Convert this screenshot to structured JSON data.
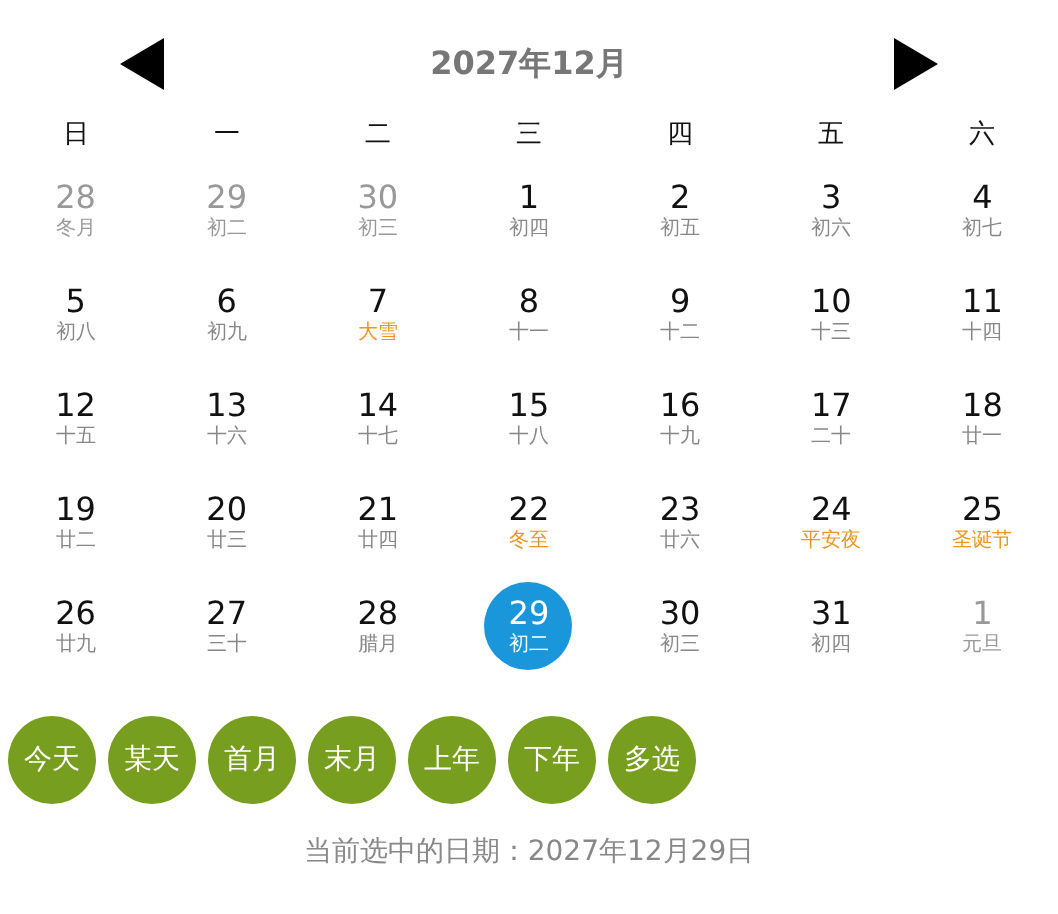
{
  "header": {
    "title": "2027年12月"
  },
  "weekdays": [
    "日",
    "一",
    "二",
    "三",
    "四",
    "五",
    "六"
  ],
  "days": [
    {
      "day": "28",
      "lunar": "冬月",
      "in_month": false,
      "festive": false,
      "selected": false
    },
    {
      "day": "29",
      "lunar": "初二",
      "in_month": false,
      "festive": false,
      "selected": false
    },
    {
      "day": "30",
      "lunar": "初三",
      "in_month": false,
      "festive": false,
      "selected": false
    },
    {
      "day": "1",
      "lunar": "初四",
      "in_month": true,
      "festive": false,
      "selected": false
    },
    {
      "day": "2",
      "lunar": "初五",
      "in_month": true,
      "festive": false,
      "selected": false
    },
    {
      "day": "3",
      "lunar": "初六",
      "in_month": true,
      "festive": false,
      "selected": false
    },
    {
      "day": "4",
      "lunar": "初七",
      "in_month": true,
      "festive": false,
      "selected": false
    },
    {
      "day": "5",
      "lunar": "初八",
      "in_month": true,
      "festive": false,
      "selected": false
    },
    {
      "day": "6",
      "lunar": "初九",
      "in_month": true,
      "festive": false,
      "selected": false
    },
    {
      "day": "7",
      "lunar": "大雪",
      "in_month": true,
      "festive": true,
      "selected": false
    },
    {
      "day": "8",
      "lunar": "十一",
      "in_month": true,
      "festive": false,
      "selected": false
    },
    {
      "day": "9",
      "lunar": "十二",
      "in_month": true,
      "festive": false,
      "selected": false
    },
    {
      "day": "10",
      "lunar": "十三",
      "in_month": true,
      "festive": false,
      "selected": false
    },
    {
      "day": "11",
      "lunar": "十四",
      "in_month": true,
      "festive": false,
      "selected": false
    },
    {
      "day": "12",
      "lunar": "十五",
      "in_month": true,
      "festive": false,
      "selected": false
    },
    {
      "day": "13",
      "lunar": "十六",
      "in_month": true,
      "festive": false,
      "selected": false
    },
    {
      "day": "14",
      "lunar": "十七",
      "in_month": true,
      "festive": false,
      "selected": false
    },
    {
      "day": "15",
      "lunar": "十八",
      "in_month": true,
      "festive": false,
      "selected": false
    },
    {
      "day": "16",
      "lunar": "十九",
      "in_month": true,
      "festive": false,
      "selected": false
    },
    {
      "day": "17",
      "lunar": "二十",
      "in_month": true,
      "festive": false,
      "selected": false
    },
    {
      "day": "18",
      "lunar": "廿一",
      "in_month": true,
      "festive": false,
      "selected": false
    },
    {
      "day": "19",
      "lunar": "廿二",
      "in_month": true,
      "festive": false,
      "selected": false
    },
    {
      "day": "20",
      "lunar": "廿三",
      "in_month": true,
      "festive": false,
      "selected": false
    },
    {
      "day": "21",
      "lunar": "廿四",
      "in_month": true,
      "festive": false,
      "selected": false
    },
    {
      "day": "22",
      "lunar": "冬至",
      "in_month": true,
      "festive": true,
      "selected": false
    },
    {
      "day": "23",
      "lunar": "廿六",
      "in_month": true,
      "festive": false,
      "selected": false
    },
    {
      "day": "24",
      "lunar": "平安夜",
      "in_month": true,
      "festive": true,
      "selected": false
    },
    {
      "day": "25",
      "lunar": "圣诞节",
      "in_month": true,
      "festive": true,
      "selected": false
    },
    {
      "day": "26",
      "lunar": "廿九",
      "in_month": true,
      "festive": false,
      "selected": false
    },
    {
      "day": "27",
      "lunar": "三十",
      "in_month": true,
      "festive": false,
      "selected": false
    },
    {
      "day": "28",
      "lunar": "腊月",
      "in_month": true,
      "festive": false,
      "selected": false
    },
    {
      "day": "29",
      "lunar": "初二",
      "in_month": true,
      "festive": false,
      "selected": true
    },
    {
      "day": "30",
      "lunar": "初三",
      "in_month": true,
      "festive": false,
      "selected": false
    },
    {
      "day": "31",
      "lunar": "初四",
      "in_month": true,
      "festive": false,
      "selected": false
    },
    {
      "day": "1",
      "lunar": "元旦",
      "in_month": false,
      "festive": false,
      "selected": false
    }
  ],
  "buttons": [
    "今天",
    "某天",
    "首月",
    "末月",
    "上年",
    "下年",
    "多选"
  ],
  "status": "当前选中的日期：2027年12月29日"
}
